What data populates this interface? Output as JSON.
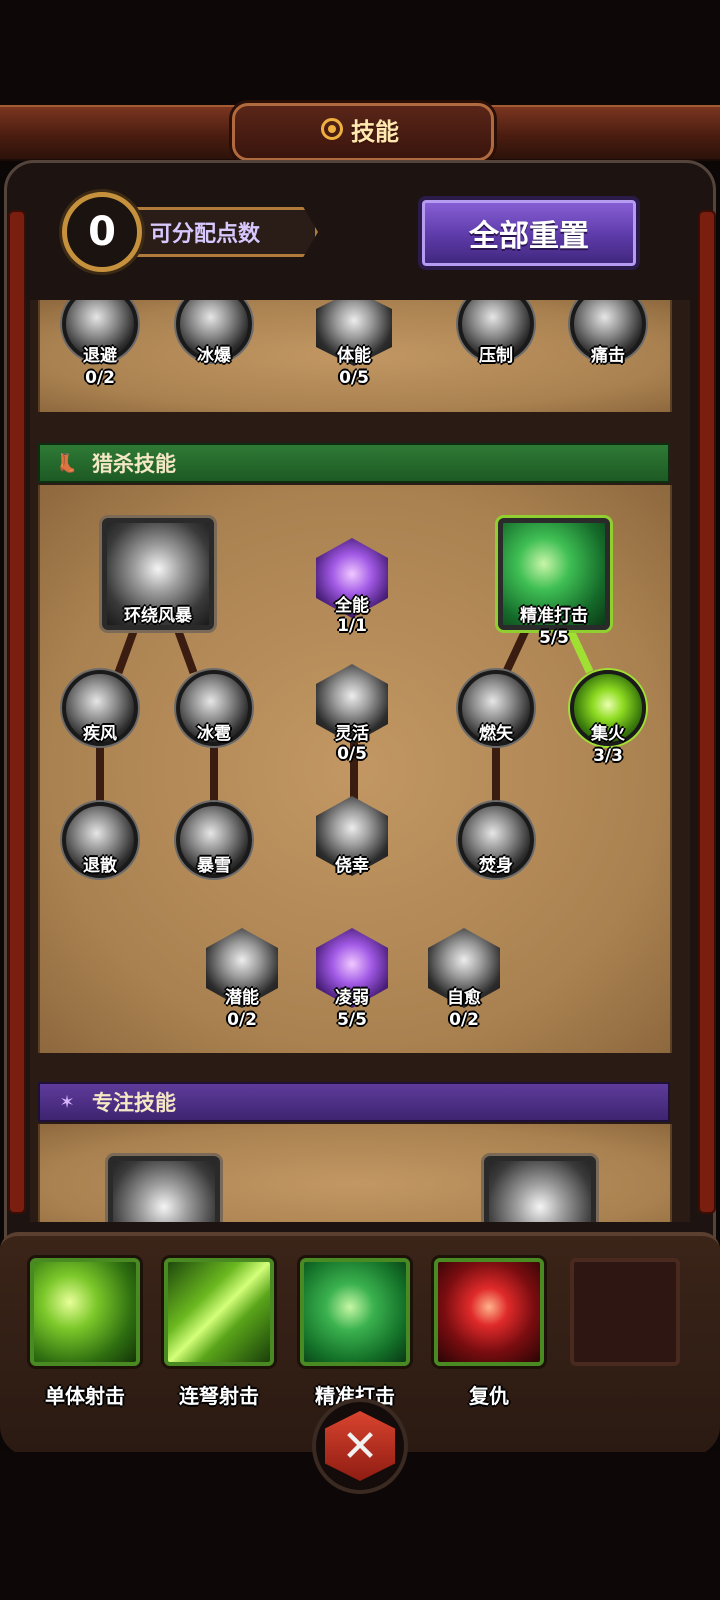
{
  "header": {
    "title": "技能",
    "icon": "gear-dot-icon"
  },
  "points": {
    "value": "0",
    "label": "可分配点数"
  },
  "reset_button": {
    "label": "全部重置"
  },
  "top_row": [
    {
      "name": "退避",
      "level": "0/2"
    },
    {
      "name": "冰爆",
      "level": ""
    },
    {
      "name": "体能",
      "level": "0/5"
    },
    {
      "name": "压制",
      "level": ""
    },
    {
      "name": "痛击",
      "level": ""
    }
  ],
  "sections": {
    "hunt": {
      "title": "猎杀技能",
      "color": "#2f7a35"
    },
    "focus": {
      "title": "专注技能",
      "color": "#5e3b9b"
    }
  },
  "hunt_skills": {
    "storm": {
      "name": "环绕风暴",
      "level": ""
    },
    "omni": {
      "name": "全能",
      "level": "1/1"
    },
    "precise": {
      "name": "精准打击",
      "level": "5/5"
    },
    "gale": {
      "name": "疾风",
      "level": ""
    },
    "hail": {
      "name": "冰雹",
      "level": ""
    },
    "agile": {
      "name": "灵活",
      "level": "0/5"
    },
    "burn_arrow": {
      "name": "燃矢",
      "level": ""
    },
    "focus_fire": {
      "name": "集火",
      "level": "3/3"
    },
    "disperse": {
      "name": "退散",
      "level": ""
    },
    "blizzard": {
      "name": "暴雪",
      "level": ""
    },
    "lucky": {
      "name": "侥幸",
      "level": ""
    },
    "immolate": {
      "name": "焚身",
      "level": ""
    },
    "potential": {
      "name": "潜能",
      "level": "0/2"
    },
    "weaken": {
      "name": "凌弱",
      "level": "5/5"
    },
    "heal": {
      "name": "自愈",
      "level": "0/2"
    }
  },
  "equipped": [
    {
      "name": "单体射击"
    },
    {
      "name": "连弩射击"
    },
    {
      "name": "精准打击"
    },
    {
      "name": "复仇"
    }
  ],
  "close_icon": "crossed-swords-icon"
}
